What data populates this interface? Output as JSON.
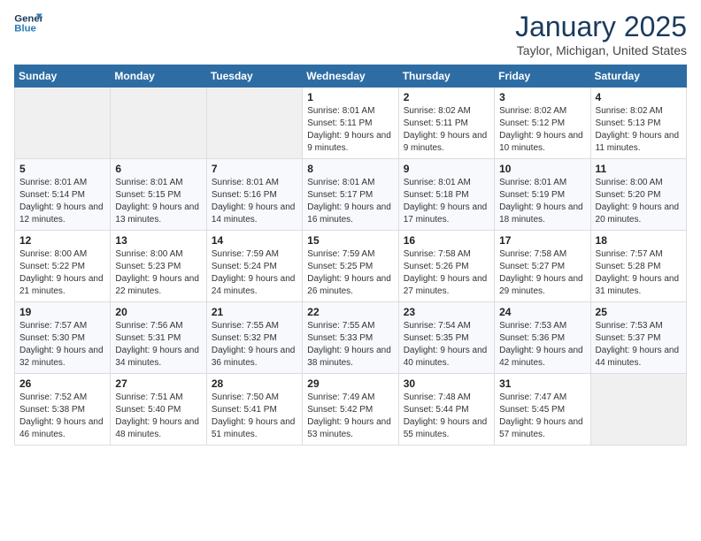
{
  "header": {
    "logo_line1": "General",
    "logo_line2": "Blue",
    "month": "January 2025",
    "location": "Taylor, Michigan, United States"
  },
  "weekdays": [
    "Sunday",
    "Monday",
    "Tuesday",
    "Wednesday",
    "Thursday",
    "Friday",
    "Saturday"
  ],
  "weeks": [
    [
      {
        "day": "",
        "info": ""
      },
      {
        "day": "",
        "info": ""
      },
      {
        "day": "",
        "info": ""
      },
      {
        "day": "1",
        "info": "Sunrise: 8:01 AM\nSunset: 5:11 PM\nDaylight: 9 hours and 9 minutes."
      },
      {
        "day": "2",
        "info": "Sunrise: 8:02 AM\nSunset: 5:11 PM\nDaylight: 9 hours and 9 minutes."
      },
      {
        "day": "3",
        "info": "Sunrise: 8:02 AM\nSunset: 5:12 PM\nDaylight: 9 hours and 10 minutes."
      },
      {
        "day": "4",
        "info": "Sunrise: 8:02 AM\nSunset: 5:13 PM\nDaylight: 9 hours and 11 minutes."
      }
    ],
    [
      {
        "day": "5",
        "info": "Sunrise: 8:01 AM\nSunset: 5:14 PM\nDaylight: 9 hours and 12 minutes."
      },
      {
        "day": "6",
        "info": "Sunrise: 8:01 AM\nSunset: 5:15 PM\nDaylight: 9 hours and 13 minutes."
      },
      {
        "day": "7",
        "info": "Sunrise: 8:01 AM\nSunset: 5:16 PM\nDaylight: 9 hours and 14 minutes."
      },
      {
        "day": "8",
        "info": "Sunrise: 8:01 AM\nSunset: 5:17 PM\nDaylight: 9 hours and 16 minutes."
      },
      {
        "day": "9",
        "info": "Sunrise: 8:01 AM\nSunset: 5:18 PM\nDaylight: 9 hours and 17 minutes."
      },
      {
        "day": "10",
        "info": "Sunrise: 8:01 AM\nSunset: 5:19 PM\nDaylight: 9 hours and 18 minutes."
      },
      {
        "day": "11",
        "info": "Sunrise: 8:00 AM\nSunset: 5:20 PM\nDaylight: 9 hours and 20 minutes."
      }
    ],
    [
      {
        "day": "12",
        "info": "Sunrise: 8:00 AM\nSunset: 5:22 PM\nDaylight: 9 hours and 21 minutes."
      },
      {
        "day": "13",
        "info": "Sunrise: 8:00 AM\nSunset: 5:23 PM\nDaylight: 9 hours and 22 minutes."
      },
      {
        "day": "14",
        "info": "Sunrise: 7:59 AM\nSunset: 5:24 PM\nDaylight: 9 hours and 24 minutes."
      },
      {
        "day": "15",
        "info": "Sunrise: 7:59 AM\nSunset: 5:25 PM\nDaylight: 9 hours and 26 minutes."
      },
      {
        "day": "16",
        "info": "Sunrise: 7:58 AM\nSunset: 5:26 PM\nDaylight: 9 hours and 27 minutes."
      },
      {
        "day": "17",
        "info": "Sunrise: 7:58 AM\nSunset: 5:27 PM\nDaylight: 9 hours and 29 minutes."
      },
      {
        "day": "18",
        "info": "Sunrise: 7:57 AM\nSunset: 5:28 PM\nDaylight: 9 hours and 31 minutes."
      }
    ],
    [
      {
        "day": "19",
        "info": "Sunrise: 7:57 AM\nSunset: 5:30 PM\nDaylight: 9 hours and 32 minutes."
      },
      {
        "day": "20",
        "info": "Sunrise: 7:56 AM\nSunset: 5:31 PM\nDaylight: 9 hours and 34 minutes."
      },
      {
        "day": "21",
        "info": "Sunrise: 7:55 AM\nSunset: 5:32 PM\nDaylight: 9 hours and 36 minutes."
      },
      {
        "day": "22",
        "info": "Sunrise: 7:55 AM\nSunset: 5:33 PM\nDaylight: 9 hours and 38 minutes."
      },
      {
        "day": "23",
        "info": "Sunrise: 7:54 AM\nSunset: 5:35 PM\nDaylight: 9 hours and 40 minutes."
      },
      {
        "day": "24",
        "info": "Sunrise: 7:53 AM\nSunset: 5:36 PM\nDaylight: 9 hours and 42 minutes."
      },
      {
        "day": "25",
        "info": "Sunrise: 7:53 AM\nSunset: 5:37 PM\nDaylight: 9 hours and 44 minutes."
      }
    ],
    [
      {
        "day": "26",
        "info": "Sunrise: 7:52 AM\nSunset: 5:38 PM\nDaylight: 9 hours and 46 minutes."
      },
      {
        "day": "27",
        "info": "Sunrise: 7:51 AM\nSunset: 5:40 PM\nDaylight: 9 hours and 48 minutes."
      },
      {
        "day": "28",
        "info": "Sunrise: 7:50 AM\nSunset: 5:41 PM\nDaylight: 9 hours and 51 minutes."
      },
      {
        "day": "29",
        "info": "Sunrise: 7:49 AM\nSunset: 5:42 PM\nDaylight: 9 hours and 53 minutes."
      },
      {
        "day": "30",
        "info": "Sunrise: 7:48 AM\nSunset: 5:44 PM\nDaylight: 9 hours and 55 minutes."
      },
      {
        "day": "31",
        "info": "Sunrise: 7:47 AM\nSunset: 5:45 PM\nDaylight: 9 hours and 57 minutes."
      },
      {
        "day": "",
        "info": ""
      }
    ]
  ]
}
